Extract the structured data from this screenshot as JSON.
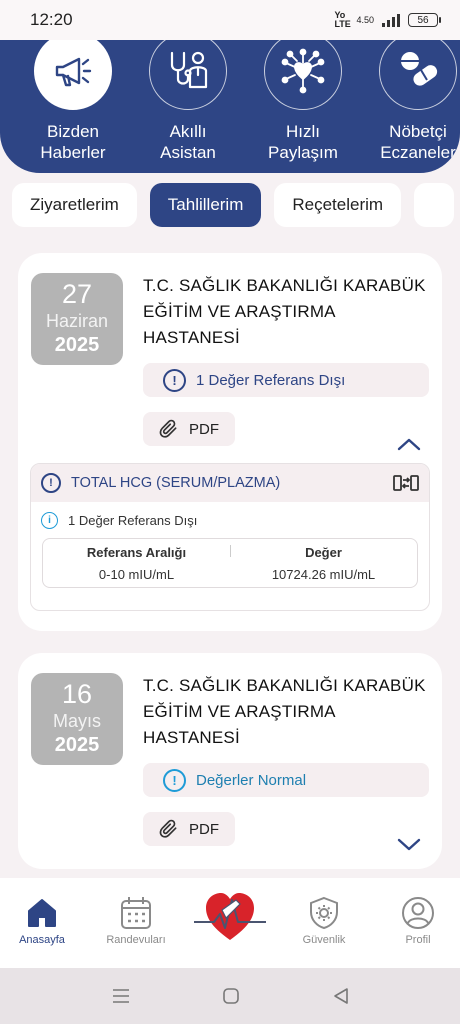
{
  "status_bar": {
    "time": "12:20",
    "network": "Yo LTE",
    "speed": "4.50",
    "battery": "56"
  },
  "quick_actions": [
    {
      "label": "Bizden\nHaberler",
      "icon": "megaphone-icon"
    },
    {
      "label": "Akıllı\nAsistan",
      "icon": "doctor-icon"
    },
    {
      "label": "Hızlı\nPaylaşım",
      "icon": "share-heart-icon"
    },
    {
      "label": "Nöbetçi\nEczaneler",
      "icon": "pill-icon"
    }
  ],
  "tabs": [
    "Ziyaretlerim",
    "Tahlillerim",
    "Reçetelerim"
  ],
  "active_tab": "Tahlillerim",
  "results": [
    {
      "day": "27",
      "month": "Haziran",
      "year": "2025",
      "hospital": "T.C. SAĞLIK BAKANLIĞI KARABÜK EĞİTİM VE ARAŞTIRMA HASTANESİ",
      "status": "1 Değer Referans Dışı",
      "pdf_label": "PDF",
      "expanded": true,
      "detail": {
        "test_name": "TOTAL HCG (SERUM/PLAZMA)",
        "note": "1 Değer Referans Dışı",
        "ref_header": "Referans Aralığı",
        "value_header": "Değer",
        "ref_range": "0-10 mIU/mL",
        "value": "10724.26 mIU/mL"
      }
    },
    {
      "day": "16",
      "month": "Mayıs",
      "year": "2025",
      "hospital": "T.C. SAĞLIK BAKANLIĞI KARABÜK EĞİTİM VE ARAŞTIRMA HASTANESİ",
      "status": "Değerler Normal",
      "pdf_label": "PDF",
      "expanded": false
    }
  ],
  "bottom_nav": [
    {
      "label": "Anasayfa",
      "icon": "home-icon",
      "active": true
    },
    {
      "label": "Randevuları",
      "icon": "calendar-icon",
      "active": false
    },
    {
      "label": "",
      "icon": "heart-logo-icon",
      "active": false
    },
    {
      "label": "Güvenlik",
      "icon": "shield-gear-icon",
      "active": false
    },
    {
      "label": "Profil",
      "icon": "profile-icon",
      "active": false
    }
  ],
  "colors": {
    "brand": "#2e4585",
    "info": "#1e9bd7",
    "heart": "#d8232a"
  }
}
